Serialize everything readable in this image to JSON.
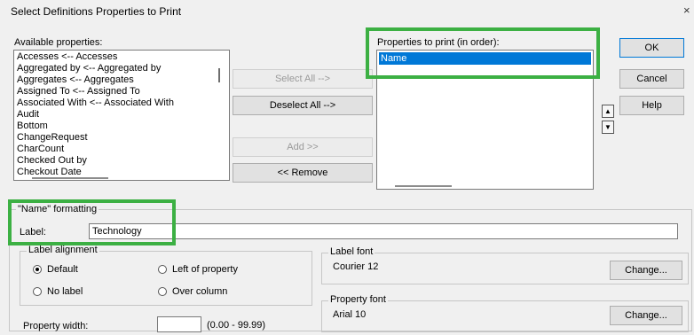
{
  "window": {
    "title": "Select Definitions Properties to Print",
    "close_glyph": "×"
  },
  "available": {
    "label": "Available properties:",
    "items": [
      "Accesses <-- Accesses",
      "Aggregated by <-- Aggregated by",
      "Aggregates <-- Aggregates",
      "Assigned To <-- Assigned To",
      "Associated With <-- Associated With",
      "Audit",
      "Bottom",
      "ChangeRequest",
      "CharCount",
      "Checked Out by",
      "Checkout Date"
    ]
  },
  "middle_buttons": {
    "select_all": "Select All -->",
    "deselect_all": "Deselect All -->",
    "add": "Add >>",
    "remove": "<< Remove"
  },
  "to_print": {
    "label": "Properties to print (in order):",
    "items": [
      "Name"
    ],
    "selected_index": 0
  },
  "order_buttons": {
    "up_glyph": "▲",
    "down_glyph": "▼"
  },
  "dialog_buttons": {
    "ok": "OK",
    "cancel": "Cancel",
    "help": "Help"
  },
  "formatting": {
    "group_title": "\"Name\" formatting",
    "label_caption": "Label:",
    "label_value": "Technology",
    "alignment": {
      "title": "Label alignment",
      "options": {
        "default": "Default",
        "left_of_property": "Left of property",
        "no_label": "No label",
        "over_column": "Over column"
      },
      "selected": "Default"
    },
    "property_width_caption": "Property width:",
    "property_width_value": "",
    "property_width_range": "(0.00 - 99.99)",
    "label_font": {
      "title": "Label font",
      "value": "Courier 12",
      "change": "Change..."
    },
    "property_font": {
      "title": "Property font",
      "value": "Arial 10",
      "change": "Change..."
    }
  },
  "colors": {
    "highlight": "#3cb043",
    "selection": "#0078d7"
  }
}
